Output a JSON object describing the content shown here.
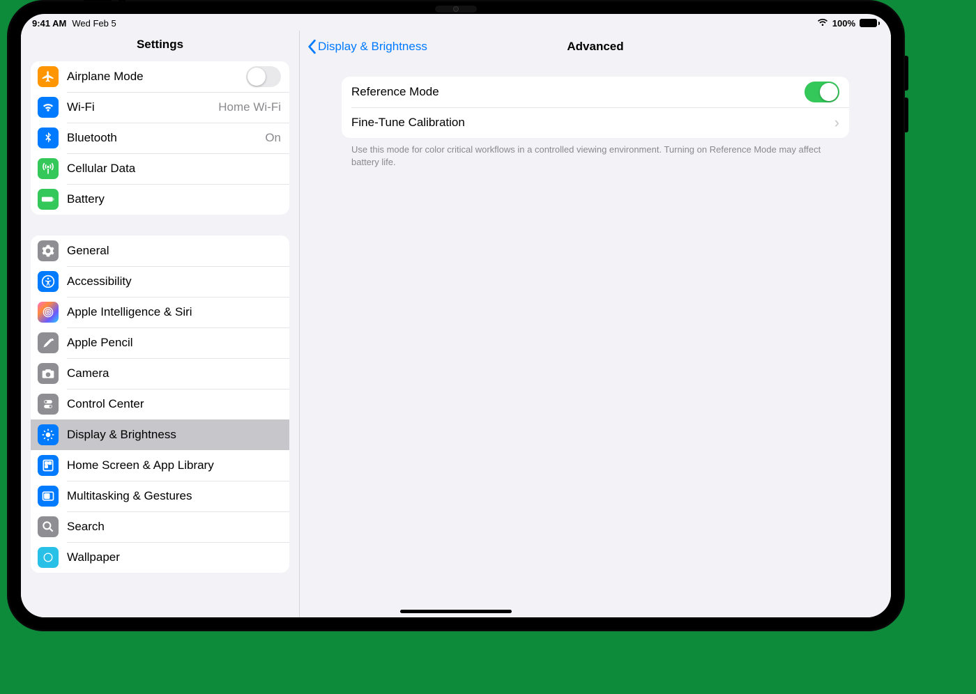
{
  "status": {
    "time": "9:41 AM",
    "date": "Wed Feb 5",
    "battery": "100%"
  },
  "sidebar": {
    "title": "Settings",
    "g1": {
      "airplane": "Airplane Mode",
      "wifi": "Wi-Fi",
      "wifi_value": "Home Wi-Fi",
      "bt": "Bluetooth",
      "bt_value": "On",
      "cell": "Cellular Data",
      "batt": "Battery"
    },
    "g2": {
      "general": "General",
      "access": "Accessibility",
      "ai": "Apple Intelligence & Siri",
      "pencil": "Apple Pencil",
      "camera": "Camera",
      "cc": "Control Center",
      "display": "Display & Brightness",
      "home": "Home Screen & App Library",
      "multi": "Multitasking & Gestures",
      "search": "Search",
      "wallpaper": "Wallpaper"
    }
  },
  "detail": {
    "back": "Display & Brightness",
    "title": "Advanced",
    "reference_mode": "Reference Mode",
    "fine_tune": "Fine-Tune Calibration",
    "footer": "Use this mode for color critical workflows in a controlled viewing environment. Turning on Reference Mode may affect battery life."
  }
}
